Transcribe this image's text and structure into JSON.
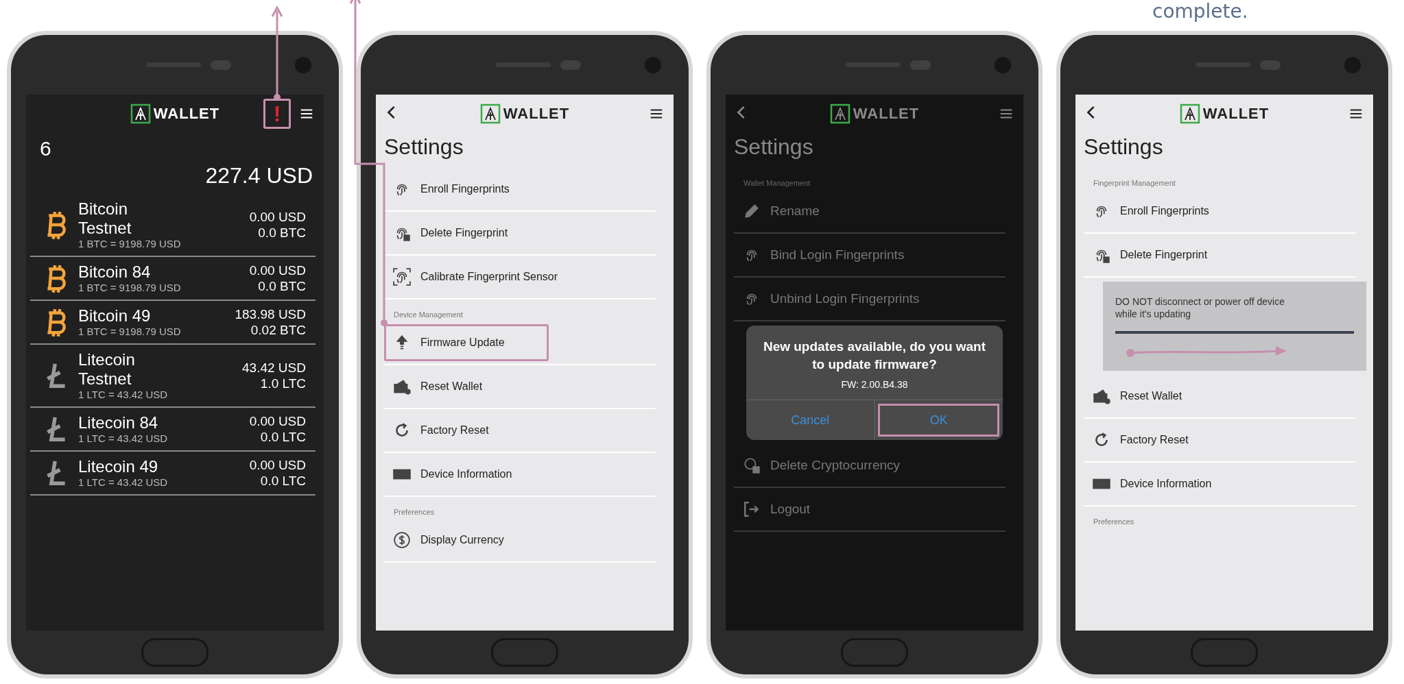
{
  "caption": "complete.",
  "phones": [
    {
      "kind": "coins",
      "header": {
        "logo": "WALLET",
        "alert": {
          "symbol": "!",
          "highlighted": true
        }
      },
      "count": "6",
      "total": "227.4 USD",
      "coins": [
        {
          "name": "Bitcoin Testnet",
          "rate": "1 BTC = 9198.79 USD",
          "fiat": "0.00 USD",
          "amount": "0.0 BTC"
        },
        {
          "name": "Bitcoin 84",
          "rate": "1 BTC = 9198.79 USD",
          "fiat": "0.00 USD",
          "amount": "0.0 BTC"
        },
        {
          "name": "Bitcoin 49",
          "rate": "1 BTC = 9198.79 USD",
          "fiat": "183.98 USD",
          "amount": "0.02 BTC"
        },
        {
          "name": "Litecoin Testnet",
          "rate": "1 LTC = 43.42 USD",
          "fiat": "43.42 USD",
          "amount": "1.0 LTC"
        },
        {
          "name": "Litecoin 84",
          "rate": "1 LTC = 43.42 USD",
          "fiat": "0.00 USD",
          "amount": "0.0 LTC"
        },
        {
          "name": "Litecoin 49",
          "rate": "1 LTC = 43.42 USD",
          "fiat": "0.00 USD",
          "amount": "0.0 LTC"
        }
      ]
    },
    {
      "kind": "settings",
      "dimmed": false,
      "header": {
        "back": true,
        "logo": "WALLET"
      },
      "title": "Settings",
      "entries": [
        {
          "kind": "item",
          "label": "Enroll Fingerprints",
          "highlighted": false
        },
        {
          "kind": "item",
          "label": "Delete Fingerprint",
          "highlighted": false
        },
        {
          "kind": "item",
          "label": "Calibrate Fingerprint Sensor",
          "highlighted": false
        },
        {
          "kind": "header",
          "label": "Device Management"
        },
        {
          "kind": "item",
          "label": "Firmware Update",
          "highlighted": true
        },
        {
          "kind": "item",
          "label": "Reset Wallet",
          "highlighted": false
        },
        {
          "kind": "item",
          "label": "Factory Reset",
          "highlighted": false
        },
        {
          "kind": "item",
          "label": "Device Information",
          "highlighted": false
        },
        {
          "kind": "header",
          "label": "Preferences"
        },
        {
          "kind": "item",
          "label": "Display Currency",
          "highlighted": false
        }
      ]
    },
    {
      "kind": "settings",
      "dimmed": true,
      "header": {
        "back": true,
        "logo": "WALLET"
      },
      "title": "Settings",
      "entries": [
        {
          "kind": "header",
          "label": "Wallet Management"
        },
        {
          "kind": "item",
          "label": "Rename",
          "highlighted": false
        },
        {
          "kind": "item",
          "label": "Bind Login Fingerprints",
          "highlighted": false
        },
        {
          "kind": "item",
          "label": "Unbind Login Fingerprints",
          "highlighted": false
        },
        {
          "kind": "dialog",
          "message": "New updates available, do you want to update firmware?",
          "detail": "FW: 2.00.B4.38",
          "buttons": [
            {
              "label": "Cancel",
              "highlighted": false
            },
            {
              "label": "OK",
              "highlighted": true
            }
          ]
        },
        {
          "kind": "item",
          "label": "Delete Cryptocurrency",
          "highlighted": false
        },
        {
          "kind": "item",
          "label": "Logout",
          "highlighted": false
        }
      ]
    },
    {
      "kind": "settings",
      "dimmed": false,
      "header": {
        "back": true,
        "logo": "WALLET"
      },
      "title": "Settings",
      "entries": [
        {
          "kind": "header",
          "label": "Fingerprint Management"
        },
        {
          "kind": "item",
          "label": "Enroll Fingerprints",
          "highlighted": false
        },
        {
          "kind": "item",
          "label": "Delete Fingerprint",
          "highlighted": false
        },
        {
          "kind": "toast",
          "message": "DO NOT disconnect or power off device while it's updating",
          "level": 1
        },
        {
          "kind": "item",
          "label": "Reset Wallet",
          "highlighted": false
        },
        {
          "kind": "item",
          "label": "Factory Reset",
          "highlighted": false
        },
        {
          "kind": "item",
          "label": "Device Information",
          "highlighted": false
        },
        {
          "kind": "header",
          "label": "Preferences"
        }
      ]
    }
  ]
}
